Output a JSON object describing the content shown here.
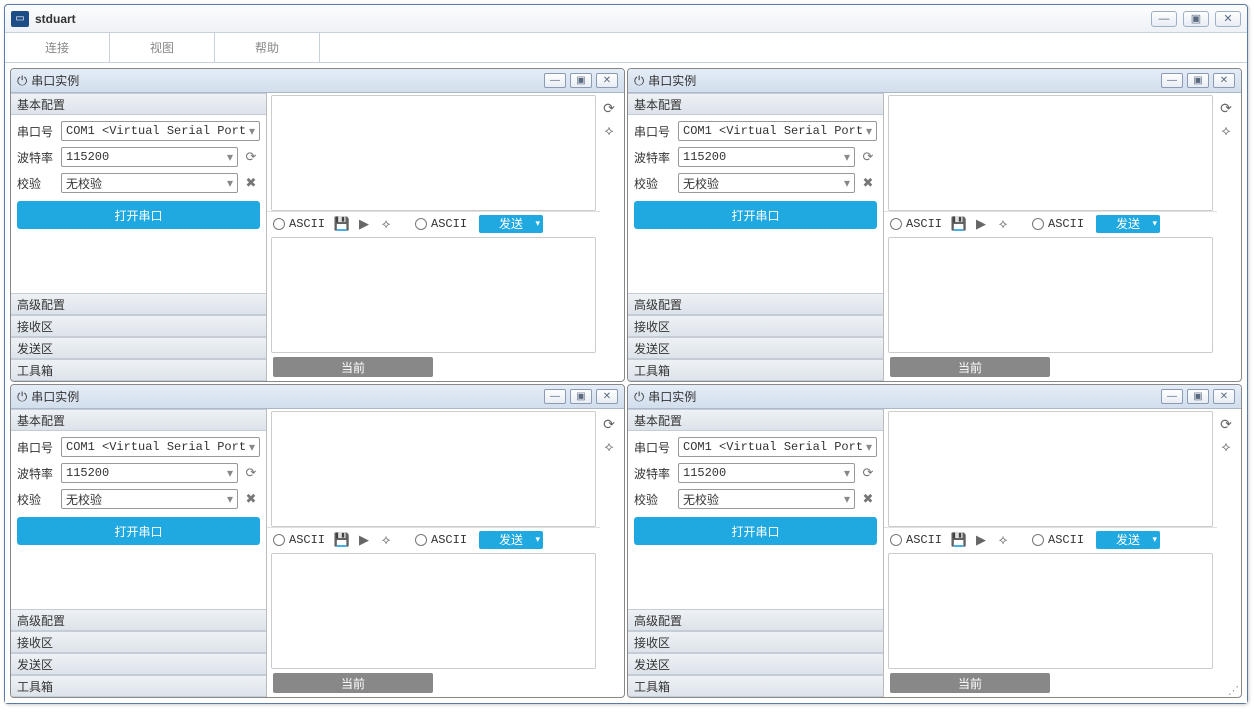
{
  "app": {
    "title": "stduart"
  },
  "menu": {
    "connect": "连接",
    "view": "视图",
    "help": "帮助"
  },
  "panel": {
    "title": "串口实例",
    "sections": {
      "basic": "基本配置",
      "advanced": "高级配置",
      "recv": "接收区",
      "send": "发送区",
      "toolbox": "工具箱"
    },
    "labels": {
      "port": "串口号",
      "baud": "波特率",
      "parity": "校验"
    },
    "values": {
      "port": "COM1 <Virtual Serial Port",
      "baud": "115200",
      "parity": "无校验"
    },
    "buttons": {
      "open": "打开串口",
      "send": "发送",
      "current": "当前"
    },
    "ascii": "ASCII"
  }
}
